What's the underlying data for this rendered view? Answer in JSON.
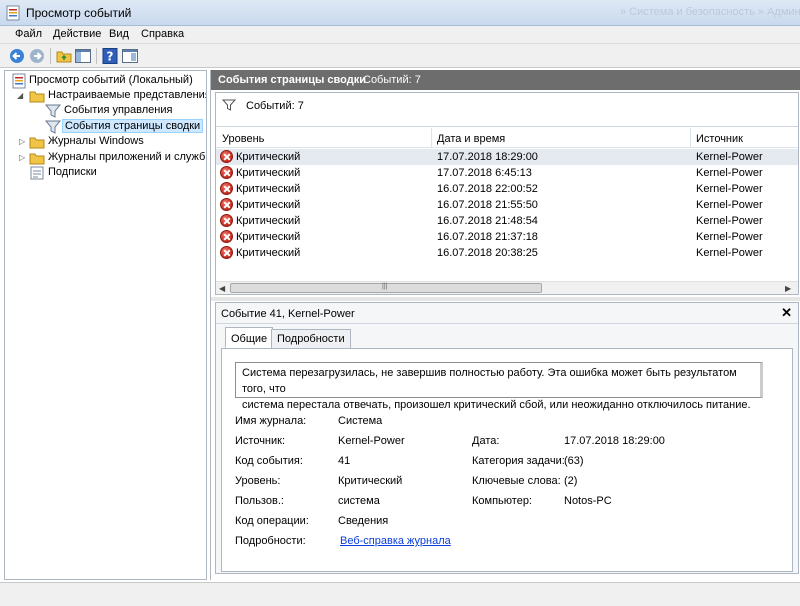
{
  "window": {
    "title": "Просмотр событий",
    "background_text": "» Система и безопасность » Админ"
  },
  "menu": [
    "Файл",
    "Действие",
    "Вид",
    "Справка"
  ],
  "toolbar": {
    "icons": [
      "back-arrow-icon",
      "forward-arrow-icon",
      "folder-up-icon",
      "show-hide-tree-icon",
      "help-icon",
      "properties-icon"
    ]
  },
  "tree": {
    "root": "Просмотр событий (Локальный)",
    "custom_views": "Настраиваемые представления",
    "admin_events": "События управления",
    "summary_events": "События страницы сводки",
    "windows_logs": "Журналы Windows",
    "apps_logs": "Журналы приложений и служб",
    "subscriptions": "Подписки"
  },
  "header": {
    "title": "События страницы сводки",
    "count_text": "Событий: 7"
  },
  "filter": {
    "text": "Событий: 7"
  },
  "columns": [
    "Уровень",
    "Дата и время",
    "Источник"
  ],
  "events": [
    {
      "level": "Критический",
      "datetime": "17.07.2018 18:29:00",
      "source": "Kernel-Power"
    },
    {
      "level": "Критический",
      "datetime": "17.07.2018 6:45:13",
      "source": "Kernel-Power"
    },
    {
      "level": "Критический",
      "datetime": "16.07.2018 22:00:52",
      "source": "Kernel-Power"
    },
    {
      "level": "Критический",
      "datetime": "16.07.2018 21:55:50",
      "source": "Kernel-Power"
    },
    {
      "level": "Критический",
      "datetime": "16.07.2018 21:48:54",
      "source": "Kernel-Power"
    },
    {
      "level": "Критический",
      "datetime": "16.07.2018 21:37:18",
      "source": "Kernel-Power"
    },
    {
      "level": "Критический",
      "datetime": "16.07.2018 20:38:25",
      "source": "Kernel-Power"
    }
  ],
  "detail": {
    "title": "Событие 41, Kernel-Power",
    "close": "✕",
    "tabs": [
      "Общие",
      "Подробности"
    ],
    "description_line1": "Система перезагрузилась, не завершив полностью работу. Эта ошибка может быть результатом того, что",
    "description_line2": "система перестала отвечать, произошел критический сбой, или неожиданно отключилось питание.",
    "fields": {
      "log_name_label": "Имя журнала:",
      "log_name": "Система",
      "source_label": "Источник:",
      "source": "Kernel-Power",
      "date_label": "Дата:",
      "date": "17.07.2018 18:29:00",
      "event_id_label": "Код события:",
      "event_id": "41",
      "task_category_label": "Категория задачи:",
      "task_category": "(63)",
      "level_label": "Уровень:",
      "level": "Критический",
      "keywords_label": "Ключевые слова:",
      "keywords": "(2)",
      "user_label": "Пользов.:",
      "user": "система",
      "computer_label": "Компьютер:",
      "computer": "Notos-PC",
      "opcode_label": "Код операции:",
      "opcode": "Сведения",
      "more_info_label": "Подробности:",
      "more_info_link": "Веб-справка журнала"
    }
  },
  "colors": {
    "error_red": "#c2281c",
    "header_gray": "#6d6d6d",
    "link_blue": "#0b3ddc"
  }
}
